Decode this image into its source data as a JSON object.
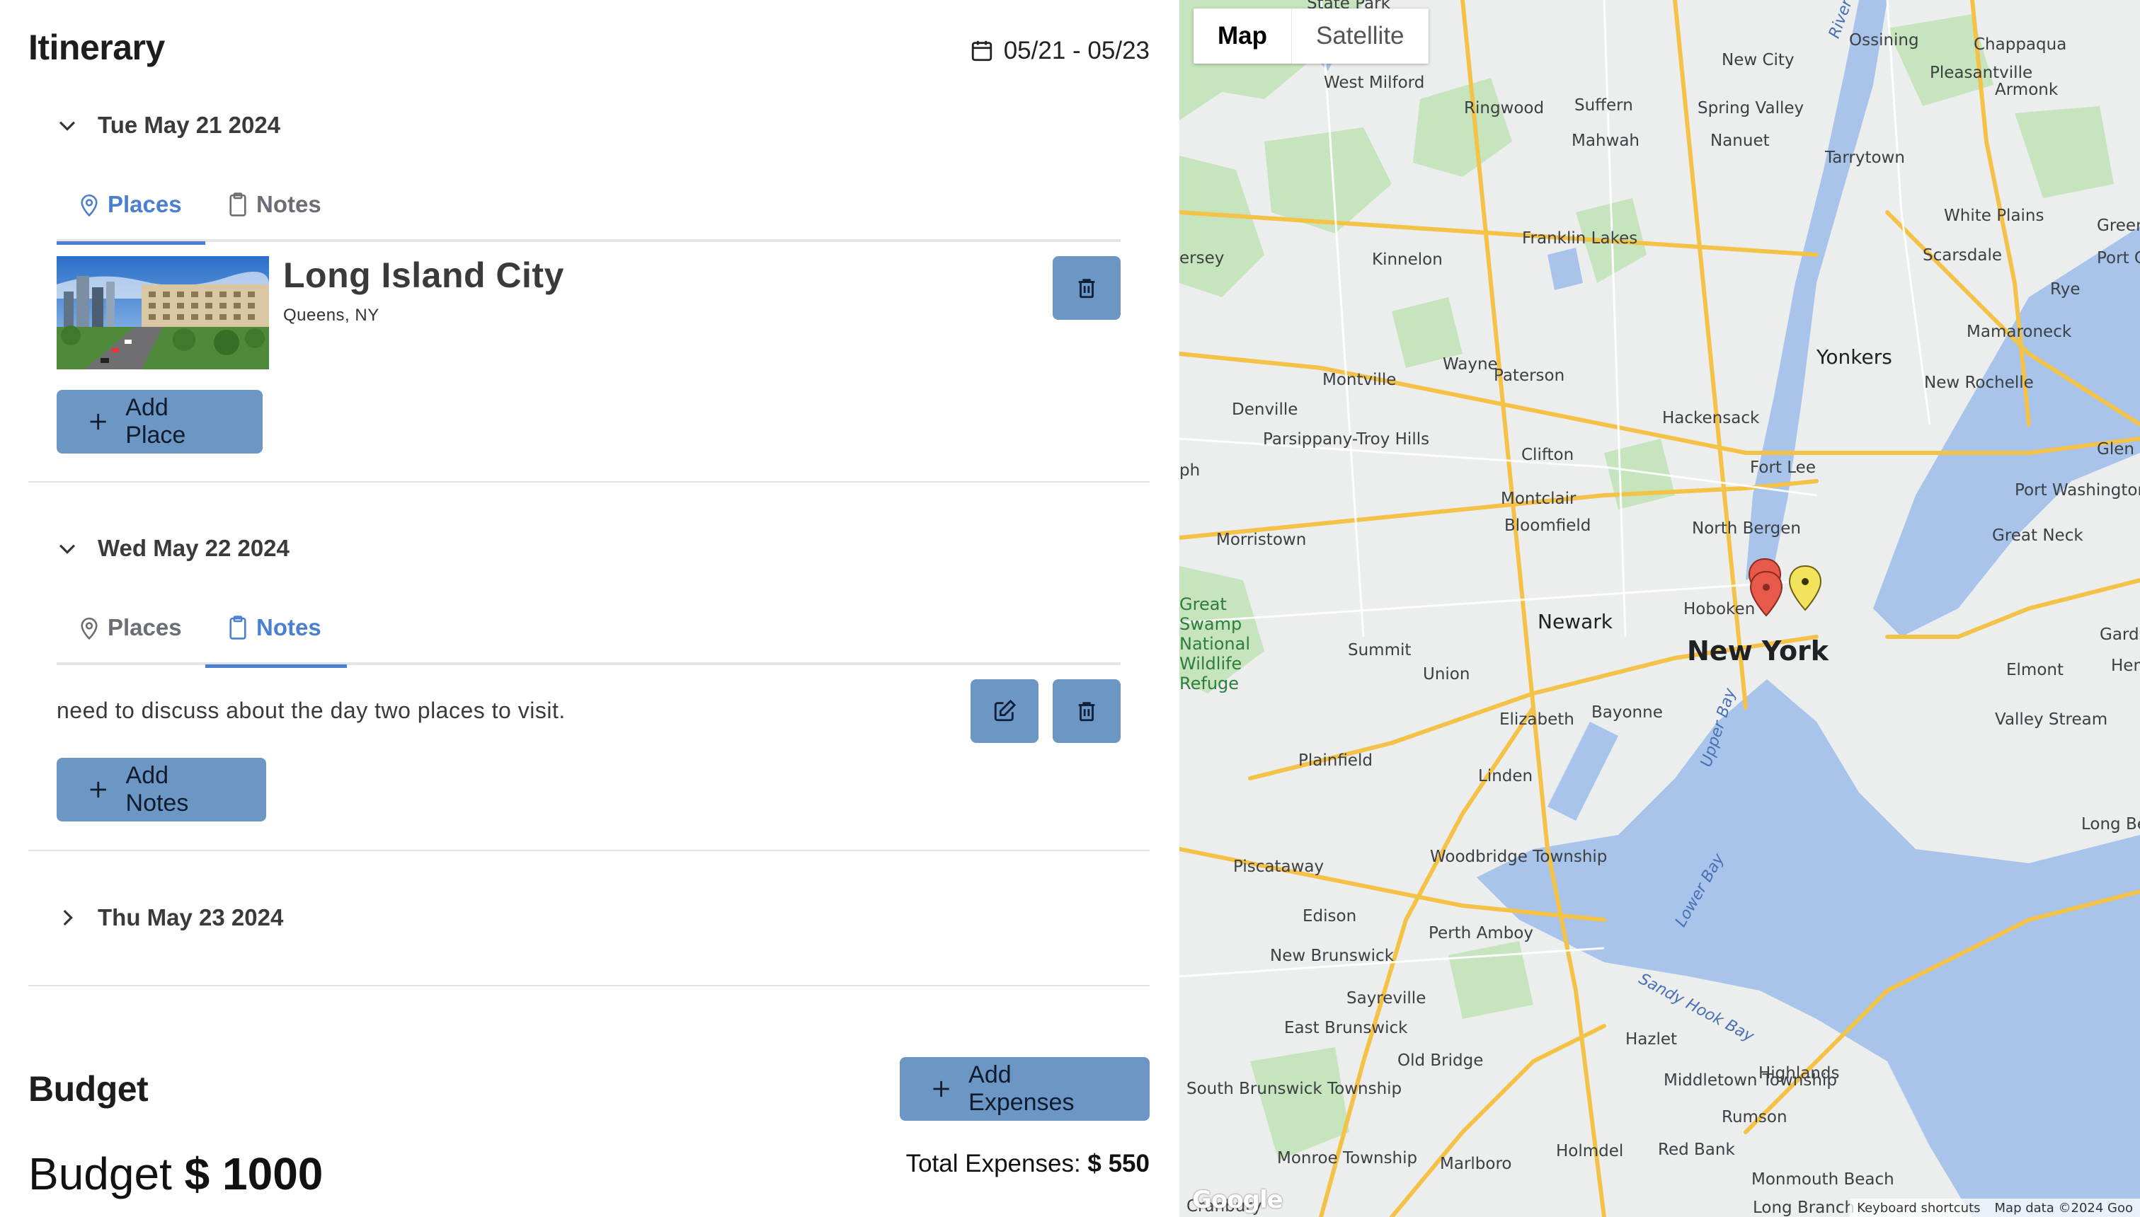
{
  "itinerary": {
    "title": "Itinerary",
    "date_range": "05/21 - 05/23",
    "days": [
      {
        "label": "Tue May 21 2024",
        "expanded": true,
        "active_tab": "Places",
        "tabs": [
          "Places",
          "Notes"
        ],
        "places": [
          {
            "name": "Long Island City",
            "address": "Queens, NY"
          }
        ],
        "add_label": "Add Place"
      },
      {
        "label": "Wed May 22 2024",
        "expanded": true,
        "active_tab": "Notes",
        "tabs": [
          "Places",
          "Notes"
        ],
        "notes": [
          "need to discuss about the day two places to visit."
        ],
        "add_label": "Add Notes"
      },
      {
        "label": "Thu May 23 2024",
        "expanded": false
      }
    ]
  },
  "budget": {
    "title": "Budget",
    "add_label": "Add Expenses",
    "budget_prefix": "Budget",
    "budget_value": "$ 1000",
    "total_label": "Total Expenses:",
    "total_value": "$ 550"
  },
  "map": {
    "type_options": [
      "Map",
      "Satellite"
    ],
    "selected_type": "Map",
    "footer": [
      "Keyboard shortcuts",
      "Map data ©2024 Goo"
    ],
    "logo": "Google",
    "city_labels": {
      "new_york": "New York",
      "newark": "Newark",
      "yonkers": "Yonkers",
      "hoboken": "Hoboken",
      "fort_lee": "Fort Lee",
      "paterson": "Paterson",
      "hackensack": "Hackensack",
      "clifton": "Clifton",
      "montclair": "Montclair",
      "bloomfield": "Bloomfield",
      "elizabeth": "Elizabeth",
      "bayonne": "Bayonne",
      "linden": "Linden",
      "union": "Union",
      "summit": "Summit",
      "plainfield": "Plainfield",
      "edison": "Edison",
      "piscataway": "Piscataway",
      "perth_amboy": "Perth Amboy",
      "woodbridge": "Woodbridge Township",
      "new_rochelle": "New Rochelle",
      "white_plains": "White Plains",
      "scarsdale": "Scarsdale",
      "tarrytown": "Tarrytown",
      "nanuet": "Nanuet",
      "spring_valley": "Spring Valley",
      "suffern": "Suffern",
      "mahwah": "Mahwah",
      "ringwood": "Ringwood",
      "west_milford": "West Milford",
      "franklin_lakes": "Franklin Lakes",
      "kinnelon": "Kinnelon",
      "wayne": "Wayne",
      "montville": "Montville",
      "denville": "Denville",
      "parsippany": "Parsippany-Troy Hills",
      "morristown": "Morristown",
      "north_bergen": "North Bergen",
      "mamaroneck": "Mamaroneck",
      "rye": "Rye",
      "port_washington": "Port Washington",
      "great_neck": "Great Neck",
      "elmont": "Elmont",
      "valley_stream": "Valley Stream",
      "long_beach": "Long Beach",
      "new_city": "New City",
      "ossining": "Ossining",
      "chappaqua": "Chappaqua",
      "armonk": "Armonk",
      "pleasantville": "Pleasantville",
      "hazlet": "Hazlet",
      "middletown": "Middletown Township",
      "highlands": "Highlands",
      "rumson": "Rumson",
      "red_bank": "Red Bank",
      "old_bridge": "Old Bridge",
      "sayreville": "Sayreville",
      "east_brunswick": "East Brunswick",
      "new_brunswick": "New Brunswick",
      "south_brunswick": "South Brunswick Township",
      "monroe": "Monroe Township",
      "marlboro": "Marlboro",
      "holmdel": "Holmdel",
      "long_branch": "Long Branch",
      "monmouth_beach": "Monmouth Beach",
      "great_swamp": "Great Swamp National Wildlife Refuge",
      "glen_cove": "Glen Cove",
      "garden_city": "Garden",
      "hempstead": "Hem",
      "green": "Green",
      "port_chester": "Port Cheste",
      "cranbury": "Cranbury",
      "jersey_stop": "ersey",
      "ph": "ph",
      "state_park": "State Park"
    },
    "water_labels": {
      "upper_bay": "Upper Bay",
      "lower_bay": "Lower Bay",
      "sandy_hook_bay": "Sandy Hook Bay",
      "river": "River"
    }
  }
}
